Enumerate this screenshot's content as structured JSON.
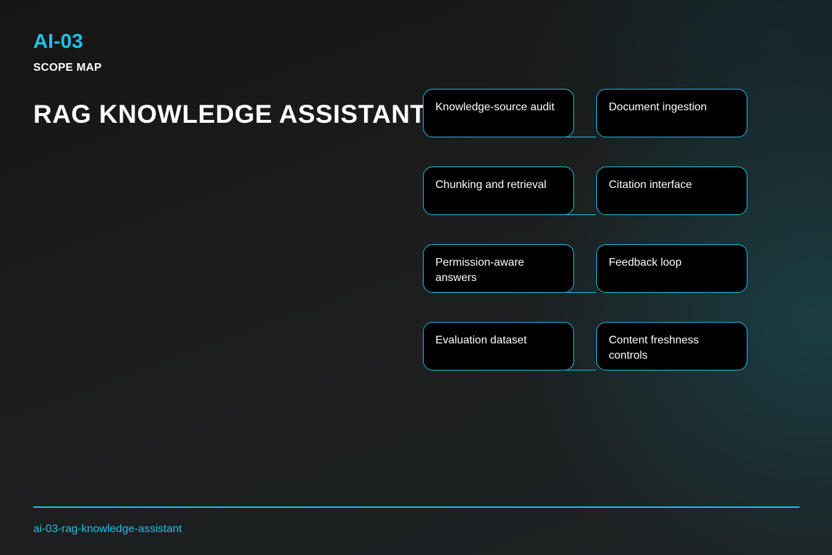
{
  "slide": {
    "code": "AI-03",
    "kicker": "SCOPE MAP",
    "title": "RAG KNOWLEDGE ASSISTANT",
    "slug": "ai-03-rag-knowledge-assistant"
  },
  "scope": {
    "items": [
      "Knowledge-source audit",
      "Document ingestion",
      "Chunking and retrieval",
      "Citation interface",
      "Permission-aware answers",
      "Feedback loop",
      "Evaluation dataset",
      "Content freshness controls"
    ]
  },
  "colors": {
    "accent": "#1cc2ea",
    "background": "#1d1d1d",
    "tile_fill": "#000000",
    "text": "#ffffff"
  }
}
